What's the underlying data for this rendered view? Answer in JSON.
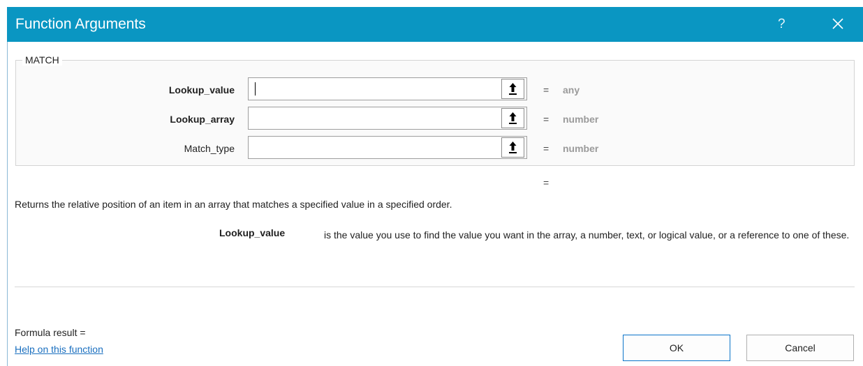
{
  "dialog": {
    "title": "Function Arguments",
    "help_label": "?",
    "function_name": "MATCH"
  },
  "arguments": [
    {
      "label": "Lookup_value",
      "value": "",
      "eq": "=",
      "hint": "any"
    },
    {
      "label": "Lookup_array",
      "value": "",
      "eq": "=",
      "hint": "number"
    },
    {
      "label": "Match_type",
      "value": "",
      "eq": "=",
      "hint": "number"
    }
  ],
  "result_eq": "=",
  "description": "Returns the relative position of an item in an array that matches a specified value in a specified order.",
  "arg_help": {
    "label": "Lookup_value",
    "text": "is the value you use to find the value you want in the array, a number, text, or logical value, or a reference to one of these."
  },
  "formula_result": "Formula result =",
  "help_link": "Help on this function",
  "buttons": {
    "ok": "OK",
    "cancel": "Cancel"
  },
  "colors": {
    "titlebar": "#0a96c2",
    "link": "#1a6fbf",
    "hint": "#9a9a9a"
  },
  "icons": {
    "close": "close-icon",
    "collapse": "collapse-dialog-icon"
  }
}
